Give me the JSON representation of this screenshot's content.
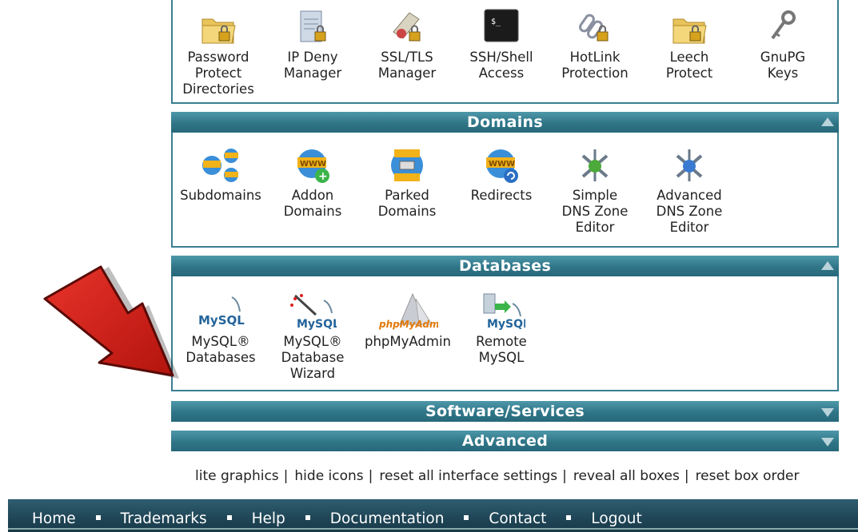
{
  "security": {
    "items": [
      {
        "label": "Password\nProtect\nDirectories",
        "icon": "folder-lock-icon"
      },
      {
        "label": "IP Deny\nManager",
        "icon": "document-lock-icon"
      },
      {
        "label": "SSL/TLS\nManager",
        "icon": "certificate-lock-icon"
      },
      {
        "label": "SSH/Shell\nAccess",
        "icon": "terminal-icon"
      },
      {
        "label": "HotLink\nProtection",
        "icon": "chain-lock-icon"
      },
      {
        "label": "Leech\nProtect",
        "icon": "folder-lock-icon"
      },
      {
        "label": "GnuPG\nKeys",
        "icon": "keys-icon"
      }
    ]
  },
  "domains": {
    "title": "Domains",
    "items": [
      {
        "label": "Subdomains",
        "icon": "subdomains-icon"
      },
      {
        "label": "Addon\nDomains",
        "icon": "addon-domains-icon"
      },
      {
        "label": "Parked\nDomains",
        "icon": "parked-domains-icon"
      },
      {
        "label": "Redirects",
        "icon": "redirects-icon"
      },
      {
        "label": "Simple\nDNS Zone\nEditor",
        "icon": "dns-zone-icon"
      },
      {
        "label": "Advanced\nDNS Zone\nEditor",
        "icon": "dns-zone-icon"
      }
    ]
  },
  "databases": {
    "title": "Databases",
    "items": [
      {
        "label": "MySQL®\nDatabases",
        "icon": "mysql-icon",
        "logo_text": "MySQL"
      },
      {
        "label": "MySQL®\nDatabase\nWizard",
        "icon": "mysql-wizard-icon",
        "logo_text": "MySQL"
      },
      {
        "label": "phpMyAdmin",
        "icon": "phpmyadmin-icon",
        "logo_text": "phpMyAdmin"
      },
      {
        "label": "Remote\nMySQL",
        "icon": "remote-mysql-icon",
        "logo_text": "MySQL"
      }
    ]
  },
  "collapsed_sections": [
    {
      "title": "Software/Services"
    },
    {
      "title": "Advanced"
    }
  ],
  "links": {
    "lite_graphics": "lite graphics",
    "hide_icons": "hide icons",
    "reset_all": "reset all interface settings",
    "reveal_all": "reveal all boxes",
    "reset_order": "reset box order",
    "separator": "|"
  },
  "footer": {
    "items": [
      "Home",
      "Trademarks",
      "Help",
      "Documentation",
      "Contact",
      "Logout"
    ]
  },
  "colors": {
    "header": "#2f7587",
    "arrow": "#cc1a12",
    "footer": "#1f4556"
  }
}
